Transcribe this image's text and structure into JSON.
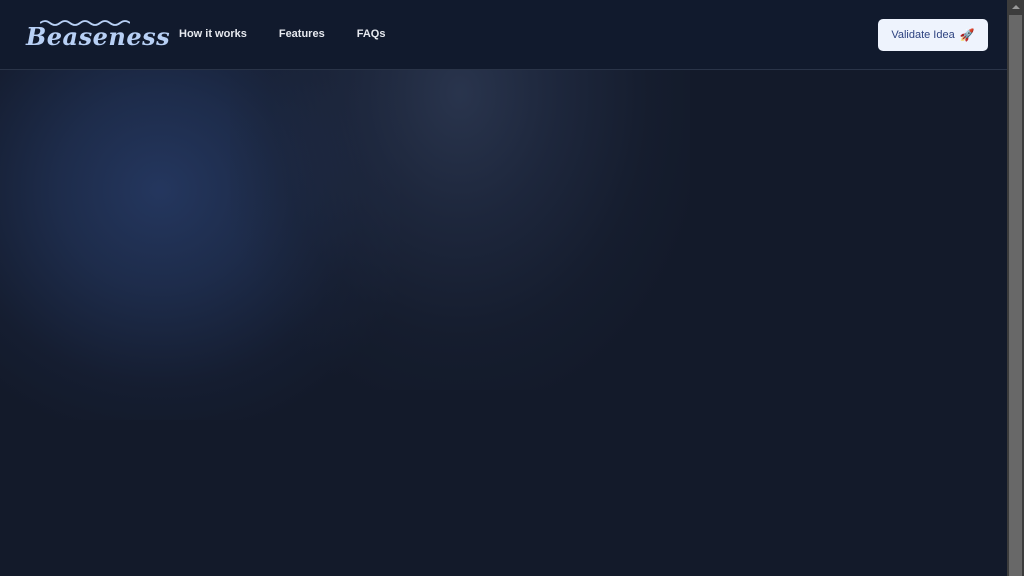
{
  "brand": {
    "name": "Beaseness",
    "logo_color": "#b8d0f5"
  },
  "nav": {
    "links": [
      {
        "label": "How it works"
      },
      {
        "label": "Features"
      },
      {
        "label": "FAQs"
      }
    ]
  },
  "cta": {
    "label": "Validate Idea",
    "icon": "rocket-icon",
    "icon_glyph": "🚀",
    "background": "#eef3fd",
    "text_color": "#2d4280"
  },
  "theme": {
    "background": "#131a2a",
    "navbar_background": "#111a2d"
  }
}
